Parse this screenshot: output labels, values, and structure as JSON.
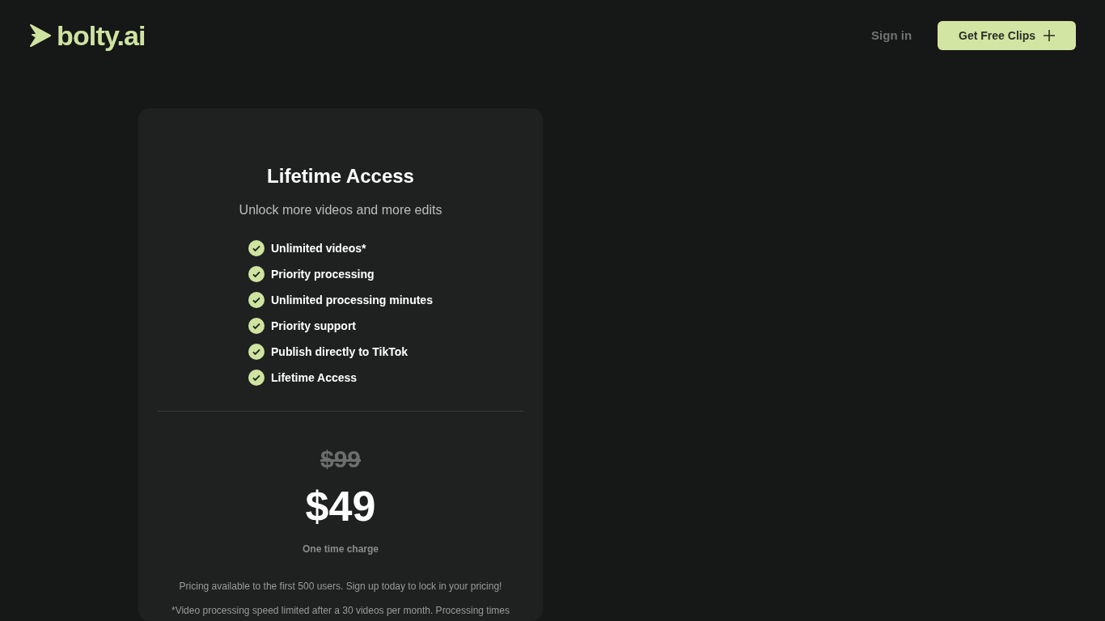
{
  "header": {
    "logo": "bolty.ai",
    "sign_in": "Sign in",
    "cta": "Get Free Clips"
  },
  "plan": {
    "title": "Lifetime Access",
    "subtitle": "Unlock more videos and more edits",
    "features": [
      "Unlimited videos*",
      "Priority processing",
      "Unlimited processing minutes",
      "Priority support",
      "Publish directly to TikTok",
      "Lifetime Access"
    ],
    "old_price": "$99",
    "price": "$49",
    "price_note": "One time charge",
    "notice": "Pricing available to the first 500 users. Sign up today to lock in your pricing!",
    "footnote": "*Video processing speed limited after a 30 videos per month. Processing times"
  }
}
